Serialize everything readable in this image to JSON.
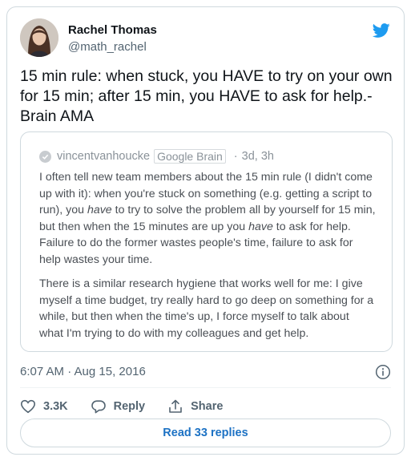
{
  "author": {
    "name": "Rachel Thomas",
    "handle": "@math_rachel"
  },
  "tweet": {
    "text": "15 min rule: when stuck, you HAVE to try on your own for 15 min; after 15 min, you HAVE to ask for help.- Brain AMA"
  },
  "quote": {
    "username": "vincentvanhoucke",
    "tag": "Google Brain",
    "separator": "·",
    "age": "3d, 3h",
    "para1_a": "I often tell new team members about the 15 min rule (I didn't come up with it): when you're stuck on something (e.g. getting a script to run), you ",
    "para1_em1": "have",
    "para1_b": " to try to solve the problem all by yourself for 15 min, but then when the 15 minutes are up you ",
    "para1_em2": "have",
    "para1_c": " to ask for help. Failure to do the former wastes people's time, failure to ask for help wastes your time.",
    "para2": "There is a similar research hygiene that works well for me: I give myself a time budget, try really hard to go deep on something for a while, but then when the time's up, I force myself to talk about what I'm trying to do with my colleagues and get help."
  },
  "meta": {
    "timestamp": "6:07 AM · Aug 15, 2016"
  },
  "actions": {
    "likes": "3.3K",
    "reply_label": "Reply",
    "share_label": "Share"
  },
  "footer": {
    "read_replies_label": "Read 33 replies"
  },
  "colors": {
    "brand_blue": "#1d9bf0",
    "link_blue": "#1d72c4",
    "text_primary": "#0f1419",
    "text_secondary": "#536471",
    "border": "#cfd9de"
  },
  "icons": [
    "twitter-bird-icon",
    "verified-check-icon",
    "info-icon",
    "heart-icon",
    "reply-bubble-icon",
    "share-icon"
  ]
}
